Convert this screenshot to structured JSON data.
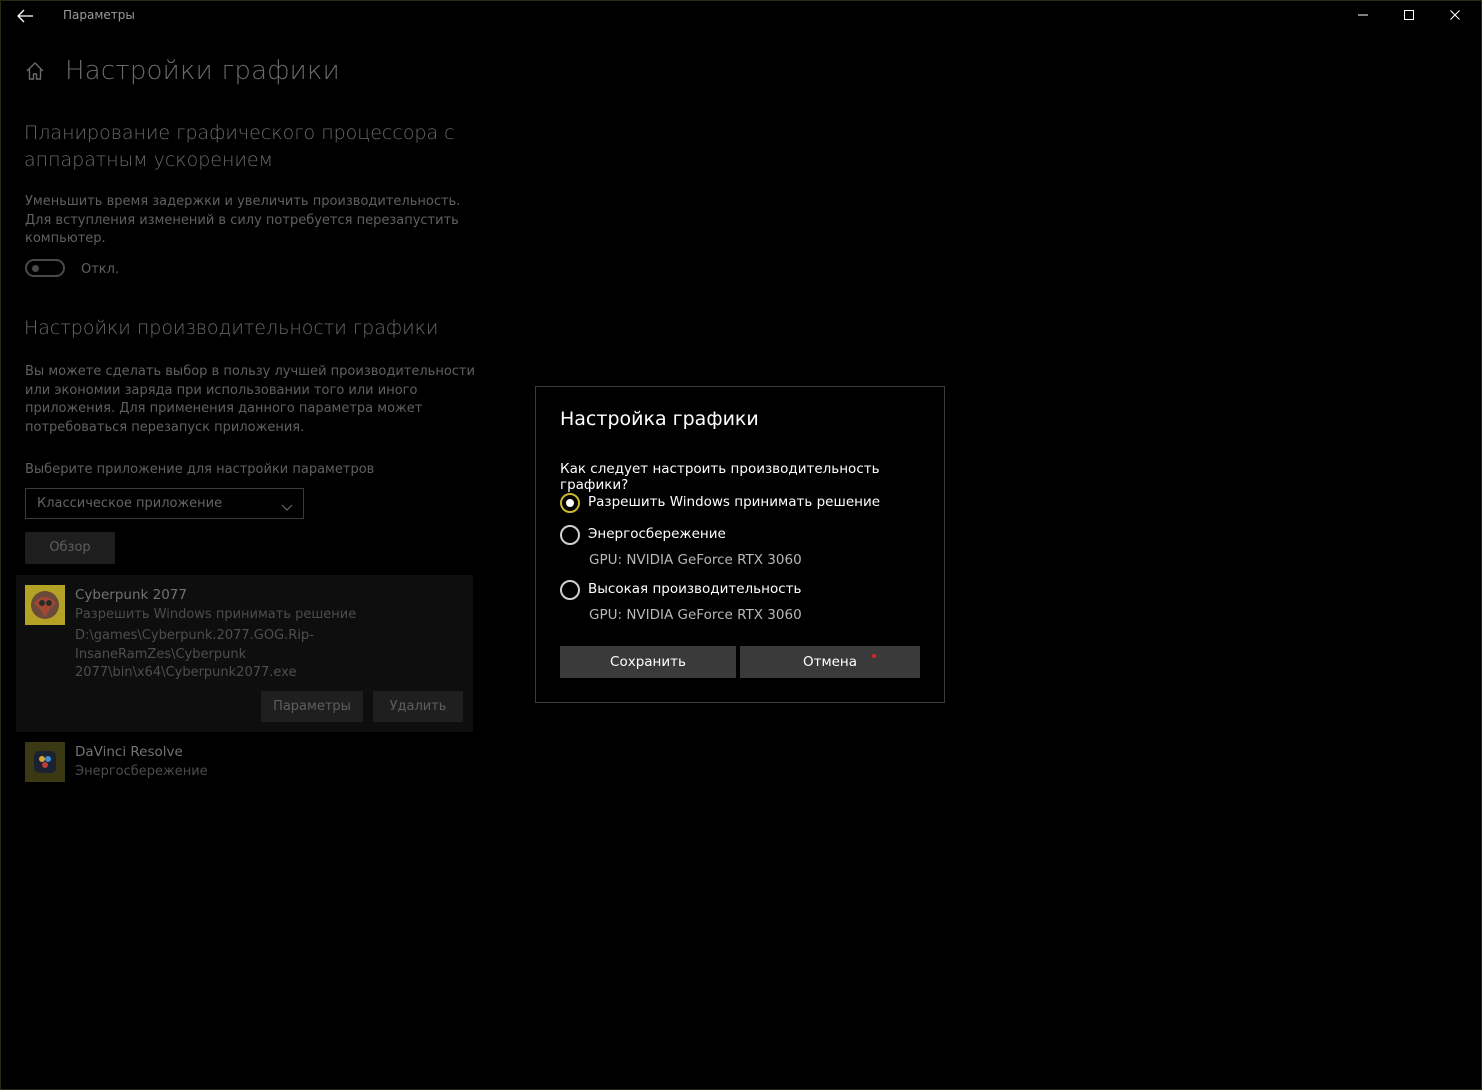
{
  "window": {
    "title": "Параметры"
  },
  "page": {
    "title": "Настройки графики"
  },
  "hags": {
    "title": "Планирование графического процессора с аппаратным ускорением",
    "description": "Уменьшить время задержки и увеличить производительность. Для вступления изменений в силу потребуется перезапустить компьютер.",
    "toggle_state": "Откл."
  },
  "perf": {
    "title": "Настройки производительности графики",
    "description": "Вы можете сделать выбор в пользу лучшей производительности или экономии заряда при использовании того или иного приложения. Для применения данного параметра может потребоваться перезапуск приложения.",
    "select_label": "Выберите приложение для настройки параметров",
    "select_value": "Классическое приложение",
    "browse_label": "Обзор"
  },
  "apps": [
    {
      "name": "Cyberpunk 2077",
      "setting": "Разрешить Windows принимать решение",
      "path": "D:\\games\\Cyberpunk.2077.GOG.Rip-InsaneRamZes\\Cyberpunk 2077\\bin\\x64\\Cyberpunk2077.exe",
      "options_label": "Параметры",
      "remove_label": "Удалить",
      "icon": "cyberpunk-app-icon"
    },
    {
      "name": "DaVinci Resolve",
      "setting": "Энергосбережение",
      "icon": "davinci-app-icon"
    }
  ],
  "dialog": {
    "title": "Настройка графики",
    "question": "Как следует настроить производительность графики?",
    "options": [
      {
        "label": "Разрешить Windows принимать решение",
        "checked": true
      },
      {
        "label": "Энергосбережение",
        "gpu": "GPU: NVIDIA GeForce RTX 3060",
        "checked": false
      },
      {
        "label": "Высокая производительность",
        "gpu": "GPU: NVIDIA GeForce RTX 3060",
        "checked": false
      }
    ],
    "save_label": "Сохранить",
    "cancel_label": "Отмена"
  },
  "colors": {
    "background": "#000000",
    "accent": "#cab52b",
    "button": "#3a3a3a",
    "dim_text": "#606060"
  }
}
